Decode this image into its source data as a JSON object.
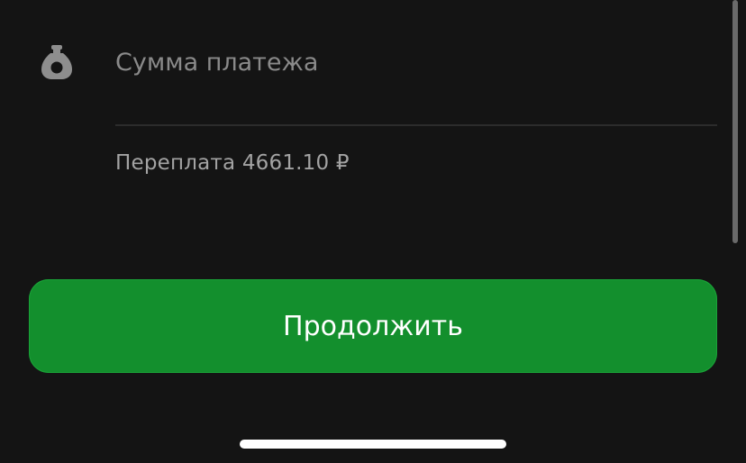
{
  "payment": {
    "amount_placeholder": "Сумма платежа",
    "amount_value": "",
    "overpayment_text": "Переплата 4661.10 ₽",
    "icon": "money-bag-icon"
  },
  "actions": {
    "continue_label": "Продолжить"
  },
  "colors": {
    "background": "#141414",
    "accent": "#138f2d",
    "secondary_text": "#a3a3a3"
  }
}
